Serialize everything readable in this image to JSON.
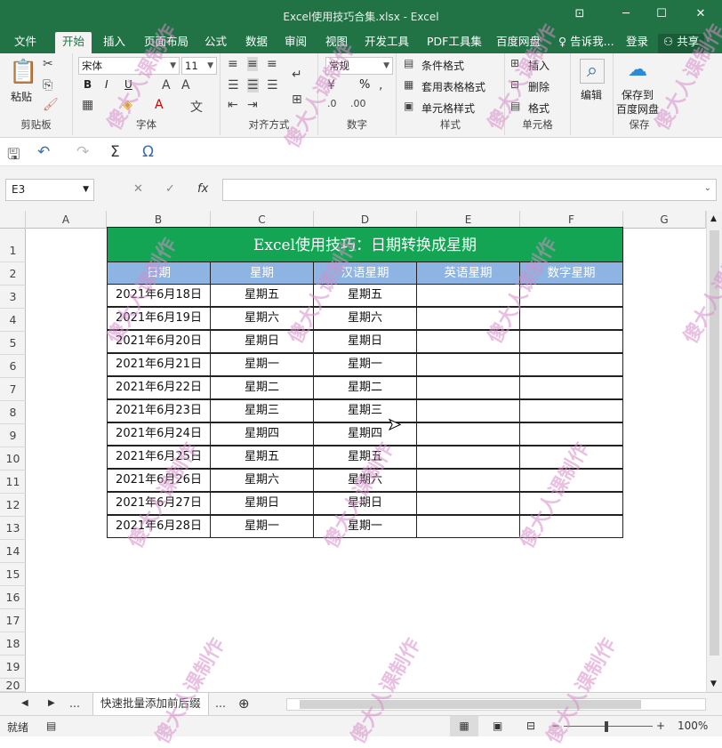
{
  "window": {
    "title": "Excel使用技巧合集.xlsx - Excel"
  },
  "tabs": [
    {
      "label": "文件"
    },
    {
      "label": "开始"
    },
    {
      "label": "插入"
    },
    {
      "label": "页面布局"
    },
    {
      "label": "公式"
    },
    {
      "label": "数据"
    },
    {
      "label": "审阅"
    },
    {
      "label": "视图"
    },
    {
      "label": "开发工具"
    },
    {
      "label": "PDF工具集"
    },
    {
      "label": "百度网盘"
    },
    {
      "label": "告诉我..."
    },
    {
      "label": "登录"
    },
    {
      "label": "共享"
    }
  ],
  "ribbon": {
    "clipboard": {
      "paste": "粘贴",
      "label": "剪贴板"
    },
    "font": {
      "name": "宋体",
      "size": "11",
      "label": "字体",
      "bold": "B",
      "italic": "I",
      "underline": "U"
    },
    "align": {
      "label": "对齐方式"
    },
    "number": {
      "format": "常规",
      "label": "数字",
      "percent": "%"
    },
    "styles": {
      "cond": "条件格式",
      "table": "套用表格格式",
      "cell": "单元格样式",
      "label": "样式"
    },
    "cells": {
      "insert": "插入",
      "delete": "删除",
      "format": "格式",
      "label": "单元格"
    },
    "edit": {
      "label": "编辑"
    },
    "save": {
      "btn1": "保存到",
      "btn2": "百度网盘",
      "label": "保存"
    }
  },
  "formula_bar": {
    "namebox": "E3",
    "fx": "fx",
    "value": ""
  },
  "columns": [
    "A",
    "B",
    "C",
    "D",
    "E",
    "F",
    "G"
  ],
  "rows": [
    "1",
    "2",
    "3",
    "4",
    "5",
    "6",
    "7",
    "8",
    "9",
    "10",
    "11",
    "12",
    "13",
    "14",
    "15",
    "16",
    "17",
    "18",
    "19",
    "20"
  ],
  "table": {
    "title": "Excel使用技巧：日期转换成星期",
    "headers": [
      "日期",
      "星期",
      "汉语星期",
      "英语星期",
      "数字星期"
    ],
    "rows": [
      [
        "2021年6月18日",
        "星期五",
        "星期五",
        "",
        ""
      ],
      [
        "2021年6月19日",
        "星期六",
        "星期六",
        "",
        ""
      ],
      [
        "2021年6月20日",
        "星期日",
        "星期日",
        "",
        ""
      ],
      [
        "2021年6月21日",
        "星期一",
        "星期一",
        "",
        ""
      ],
      [
        "2021年6月22日",
        "星期二",
        "星期二",
        "",
        ""
      ],
      [
        "2021年6月23日",
        "星期三",
        "星期三",
        "",
        ""
      ],
      [
        "2021年6月24日",
        "星期四",
        "星期四",
        "",
        ""
      ],
      [
        "2021年6月25日",
        "星期五",
        "星期五",
        "",
        ""
      ],
      [
        "2021年6月26日",
        "星期六",
        "星期六",
        "",
        ""
      ],
      [
        "2021年6月27日",
        "星期日",
        "星期日",
        "",
        ""
      ],
      [
        "2021年6月28日",
        "星期一",
        "星期一",
        "",
        ""
      ]
    ]
  },
  "sheet_tabs": {
    "current": "快速批量添加前后缀",
    "more": "..."
  },
  "status": {
    "mode": "就绪",
    "zoom": "100%"
  },
  "watermark": "傻大人课制作"
}
